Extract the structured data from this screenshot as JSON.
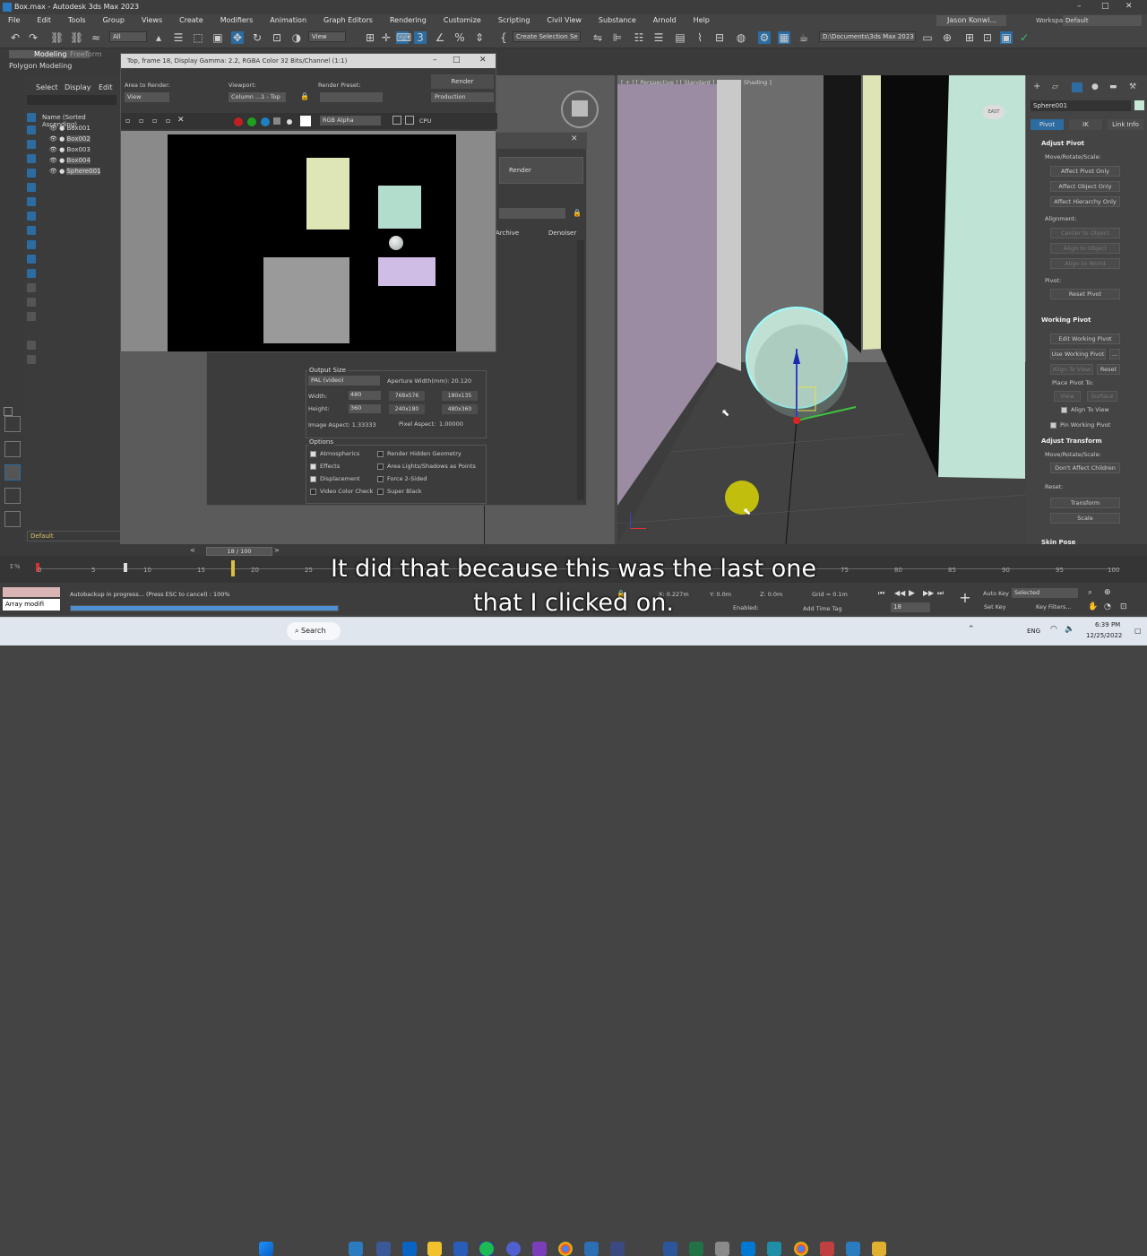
{
  "window": {
    "title": "Box.max - Autodesk 3ds Max 2023",
    "controls": [
      "–",
      "□",
      "✕"
    ]
  },
  "menu": [
    "File",
    "Edit",
    "Tools",
    "Group",
    "Views",
    "Create",
    "Modifiers",
    "Animation",
    "Graph Editors",
    "Rendering",
    "Customize",
    "Scripting",
    "Civil View",
    "Substance",
    "Arnold",
    "Help"
  ],
  "user": {
    "name": "Jason Konwi...",
    "workspaces_label": "Workspaces:",
    "workspace": "Default"
  },
  "toolbar": {
    "filter": "All",
    "view": "View",
    "selection_set": "Create Selection Se",
    "path": "D:\\Documents\\3ds Max 2023"
  },
  "ribbon": {
    "tabs": [
      "Modeling",
      "Freeform"
    ],
    "sub": "Polygon Modeling"
  },
  "explorer": {
    "tabs": [
      "Select",
      "Display",
      "Edit"
    ],
    "header": "Name (Sorted Ascending)",
    "objects": [
      "Box001",
      "Box002",
      "Box003",
      "Box004",
      "Sphere001"
    ],
    "layer": "Default"
  },
  "render_window": {
    "title": "Top, frame 18, Display Gamma: 2.2, RGBA Color 32 Bits/Channel (1:1)",
    "area_label": "Area to Render:",
    "area_value": "View",
    "viewport_label": "Viewport:",
    "viewport_value": "Column ...1 - Top",
    "preset_label": "Render Preset:",
    "preset_value": "",
    "render_btn": "Render",
    "production": "Production",
    "channel": "RGB Alpha",
    "cpu": "CPU"
  },
  "render_setup": {
    "render_btn": "Render",
    "tabs": [
      "Archive",
      "Denoiser"
    ],
    "output_size_label": "Output Size",
    "format": "PAL (video)",
    "aperture": "Aperture Width(mm): 20.120",
    "width_label": "Width:",
    "width_value": "480",
    "height_label": "Height:",
    "height_value": "360",
    "presets": [
      "768x576",
      "180x135",
      "240x180",
      "480x360"
    ],
    "image_aspect": "Image Aspect: 1.33333",
    "pixel_aspect_label": "Pixel Aspect:",
    "pixel_aspect": "1.00000",
    "options_label": "Options",
    "options_left": [
      [
        "Atmospherics",
        true
      ],
      [
        "Effects",
        true
      ],
      [
        "Displacement",
        true
      ],
      [
        "Video Color Check",
        false
      ]
    ],
    "options_right": [
      [
        "Render Hidden Geometry",
        false
      ],
      [
        "Area Lights/Shadows as Points",
        false
      ],
      [
        "Force 2-Sided",
        false
      ],
      [
        "Super Black",
        false
      ]
    ]
  },
  "viewport": {
    "label": "[ + ] [ Perspective ] [ Standard ] [ Default Shading ]"
  },
  "command_panel": {
    "object_name": "Sphere001",
    "tabs": [
      "Pivot",
      "IK",
      "Link Info"
    ],
    "adjust_pivot": "Adjust Pivot",
    "move_rotate_scale": "Move/Rotate/Scale:",
    "buttons1": [
      "Affect Pivot Only",
      "Affect Object Only",
      "Affect Hierarchy Only"
    ],
    "alignment": "Alignment:",
    "buttons2": [
      "Center to Object",
      "Align to Object",
      "Align to World"
    ],
    "pivot": "Pivot:",
    "reset_pivot": "Reset Pivot",
    "working_pivot": "Working Pivot",
    "edit_wp": "Edit Working Pivot",
    "use_wp": "Use Working Pivot",
    "align_view": "Align To View",
    "reset": "Reset",
    "place_pivot": "Place Pivot To:",
    "view": "View",
    "surface": "Surface",
    "align_to_view_chk": "Align To View",
    "pin_wp": "Pin Working Pivot",
    "adjust_transform": "Adjust Transform",
    "move_rotate_scale2": "Move/Rotate/Scale:",
    "dont_affect": "Don't Affect Children",
    "reset_label": "Reset:",
    "transform": "Transform",
    "scale": "Scale",
    "skin_pose": "Skin Pose"
  },
  "timeline": {
    "frame": "18 / 100",
    "ticks": [
      "0",
      "5",
      "10",
      "15",
      "20",
      "25",
      "75",
      "80",
      "85",
      "90",
      "95",
      "100"
    ]
  },
  "status": {
    "maxscript": "Array modifi",
    "message": "Autobackup in progress... (Press ESC to cancel) : 100%",
    "x": "X: 0.227m",
    "y": "Y: 0.0m",
    "z": "Z: 0.0m",
    "grid": "Grid = 0.1m",
    "enabled": "Enabled:",
    "add_time_tag": "Add Time Tag",
    "autokey": "Auto Key",
    "selected": "Selected",
    "setkey": "Set Key",
    "key_filters": "Key Filters...",
    "frame_field": "18"
  },
  "subtitle": {
    "line1": "It did that because this was the last one",
    "line2": "that I clicked on."
  },
  "taskbar": {
    "search": "Search",
    "time": "6:39 PM",
    "date": "12/25/2022",
    "lang": "ENG"
  },
  "colors": {
    "accent": "#2c6ca0",
    "sphere": "#b8dcd0",
    "box_yellow": "#dfe6b6",
    "box_green": "#b2dccc",
    "box_purple": "#cfbde6",
    "box_gray": "#9a9a9a"
  }
}
